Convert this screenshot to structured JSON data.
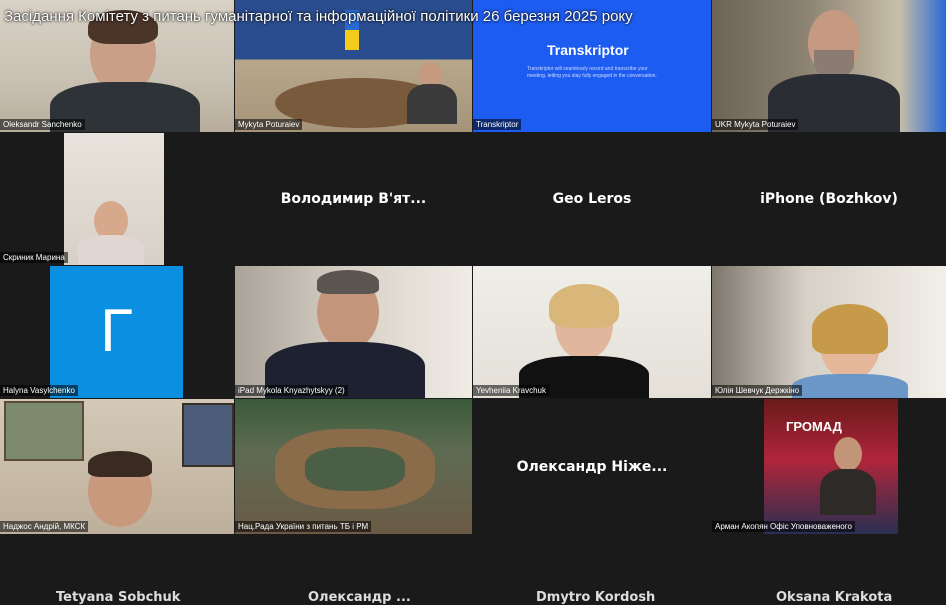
{
  "meeting": {
    "title": "Засідання Комітету з питань гуманітарної та інформаційної політики 26 березня 2025 року"
  },
  "participants": [
    {
      "id": "p1",
      "name": "Oleksandr Sanchenko",
      "type": "video"
    },
    {
      "id": "p2",
      "name": "Mykyta Poturaiev",
      "type": "video"
    },
    {
      "id": "p3",
      "name": "Transkriptor",
      "type": "video",
      "app_logo": "Transkriptor",
      "app_text": "Transkriptor will seamlessly record and transcribe your meeting, letting you stay fully engaged in the conversation."
    },
    {
      "id": "p4",
      "name": "UKR Mykyta Poturaiev",
      "type": "video"
    },
    {
      "id": "p5",
      "name": "Скриник Марина",
      "type": "video"
    },
    {
      "id": "p6",
      "name": "Володимир  В'ят...",
      "type": "name_only"
    },
    {
      "id": "p7",
      "name": "Geo Leros",
      "type": "name_only"
    },
    {
      "id": "p8",
      "name": "iPhone (Bozhkov)",
      "type": "name_only"
    },
    {
      "id": "p9",
      "name": "Halyna Vasylchenko",
      "type": "avatar",
      "avatar_letter": "Г",
      "avatar_color": "#0b8fe0"
    },
    {
      "id": "p10",
      "name": "iPad Mykola Knyazhytskyy (2)",
      "type": "video"
    },
    {
      "id": "p11",
      "name": "Yevheniia Kravchuk",
      "type": "video"
    },
    {
      "id": "p12",
      "name": "Юлія Шевчук Держкіно",
      "type": "video"
    },
    {
      "id": "p13",
      "name": "Наджос Андрій, МКСК",
      "type": "video"
    },
    {
      "id": "p14",
      "name": "Нац.Рада України з питань ТБ і РМ",
      "type": "video"
    },
    {
      "id": "p15",
      "name": "Олександр  Ніже...",
      "type": "name_only"
    },
    {
      "id": "p16",
      "name": "Арман Акопян Офіс Уповноваженого",
      "type": "video",
      "screen_text": "ГРОМАД"
    }
  ],
  "bottom_row": [
    "Tetyana Sobchuk",
    "Олександр ...",
    "Dmytro Kordosh",
    "Oksana Krakota"
  ],
  "colors": {
    "background": "#1a1a1a",
    "avatar_blue": "#0b8fe0",
    "transkriptor_blue": "#1d5cf0"
  }
}
